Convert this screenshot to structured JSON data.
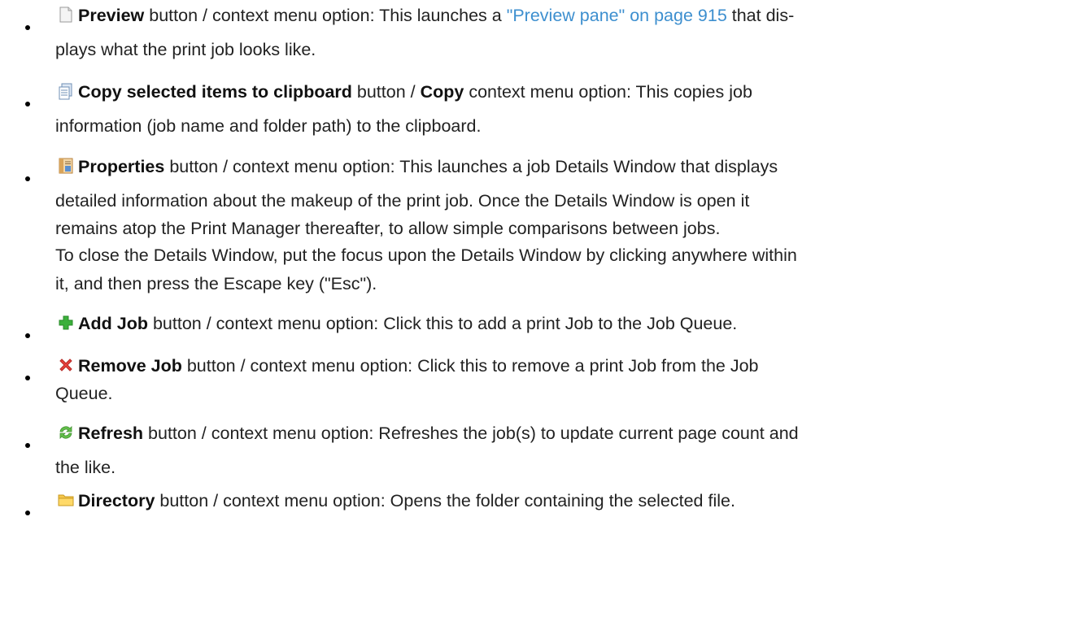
{
  "items": [
    {
      "icon": "document-icon",
      "lines": [
        {
          "label": "Preview",
          "rest_before": " button / context menu option: This launches a ",
          "link": "\"Preview pane\" on page 915",
          "rest_after": " that dis-"
        },
        {
          "text": "plays what the print job looks like."
        }
      ]
    },
    {
      "icon": "copy-icon",
      "lines": [
        {
          "label": "Copy selected items to clipboard",
          "mid": " button / ",
          "label2": "Copy",
          "rest": " context menu option: This copies job"
        },
        {
          "text": "information (job name and folder path) to the clipboard."
        }
      ]
    },
    {
      "icon": "properties-icon",
      "lines": [
        {
          "label": "Properties",
          "rest": " button / context menu option: This launches a job Details Window that displays"
        },
        {
          "text": "detailed information about the makeup of the print job. Once the Details Window is open it"
        },
        {
          "text": "remains atop the Print Manager thereafter, to allow simple comparisons between jobs."
        },
        {
          "text": "To close the Details Window, put the focus upon the Details Window by clicking anywhere within"
        },
        {
          "text": "it, and then press the Escape key (\"Esc\")."
        }
      ]
    },
    {
      "icon": "add-icon",
      "lines": [
        {
          "label": "Add Job",
          "rest": " button / context menu option: Click this to add a print Job to the Job Queue."
        }
      ]
    },
    {
      "icon": "remove-icon",
      "lines": [
        {
          "label": "Remove Job",
          "rest": " button / context menu option: Click this to remove a print Job from the Job"
        },
        {
          "text": "Queue."
        }
      ]
    },
    {
      "icon": "refresh-icon",
      "lines": [
        {
          "label": "Refresh",
          "rest": " button / context menu option: Refreshes the job(s) to update current page count and"
        },
        {
          "text": "the like."
        }
      ]
    },
    {
      "icon": "folder-icon",
      "lines": [
        {
          "label": "Directory",
          "rest": " button / context menu option: Opens the folder containing the selected file."
        }
      ]
    }
  ]
}
